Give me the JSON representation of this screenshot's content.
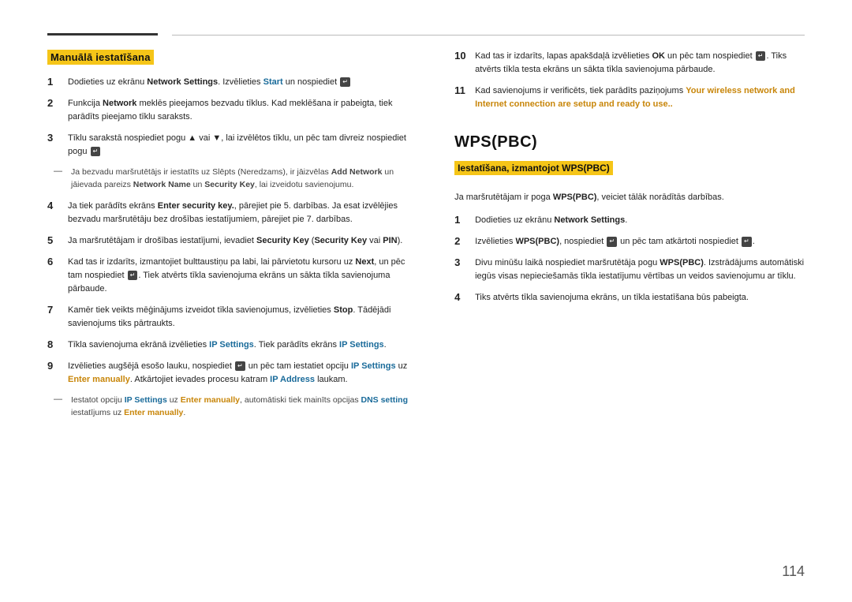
{
  "page_number": "114",
  "left_section": {
    "title": "Manuālā iestatīšana",
    "items": [
      {
        "num": "1",
        "text_parts": [
          {
            "text": "Dodieties uz ekrānu ",
            "style": "normal"
          },
          {
            "text": "Network Settings",
            "style": "bold"
          },
          {
            "text": ". Izvēlieties ",
            "style": "normal"
          },
          {
            "text": "Start",
            "style": "blue"
          },
          {
            "text": " un nospiediet ",
            "style": "normal"
          },
          {
            "text": "↵",
            "style": "icon"
          }
        ]
      },
      {
        "num": "2",
        "text_parts": [
          {
            "text": "Funkcija ",
            "style": "normal"
          },
          {
            "text": "Network",
            "style": "bold"
          },
          {
            "text": " meklēs pieejamos bezvadu tīklus. Kad meklēšana ir pabeigta, tiek parādīts pieejamo tīklu saraksts.",
            "style": "normal"
          }
        ]
      },
      {
        "num": "3",
        "text_parts": [
          {
            "text": "Tīklu sarakstā nospiediet pogu ",
            "style": "normal"
          },
          {
            "text": "▲",
            "style": "normal"
          },
          {
            "text": " vai ",
            "style": "normal"
          },
          {
            "text": "▼",
            "style": "normal"
          },
          {
            "text": ", lai izvēlētos tīklu, un pēc tam divreiz nospiediet pogu ",
            "style": "normal"
          },
          {
            "text": "↵",
            "style": "icon"
          }
        ],
        "note": {
          "dash": "—",
          "text_parts": [
            {
              "text": "Ja bezvadu maršrutētājs ir iestatīts uz Slēpts (Neredzams), ir jāizvēlas ",
              "style": "normal"
            },
            {
              "text": "Add Network",
              "style": "bold"
            },
            {
              "text": " un jāievada pareizs ",
              "style": "normal"
            },
            {
              "text": "Network Name",
              "style": "bold"
            },
            {
              "text": " un ",
              "style": "normal"
            },
            {
              "text": "Security Key",
              "style": "bold"
            },
            {
              "text": ", lai izveidotu savienojumu.",
              "style": "normal"
            }
          ]
        }
      },
      {
        "num": "4",
        "text_parts": [
          {
            "text": "Ja tiek parādīts ekrāns ",
            "style": "normal"
          },
          {
            "text": "Enter security key.",
            "style": "bold"
          },
          {
            "text": ", pārejiet pie 5. darbības. Ja esat izvēlējies bezvadu maršrutētāju bez drošības iestatījumiem, pārejiet pie 7. darbības.",
            "style": "normal"
          }
        ]
      },
      {
        "num": "5",
        "text_parts": [
          {
            "text": "Ja maršrutētājam ir drošības iestatījumi, ievadiet ",
            "style": "normal"
          },
          {
            "text": "Security Key",
            "style": "bold"
          },
          {
            "text": " (",
            "style": "normal"
          },
          {
            "text": "Security Key",
            "style": "bold"
          },
          {
            "text": " vai ",
            "style": "normal"
          },
          {
            "text": "PIN",
            "style": "bold"
          },
          {
            "text": ").",
            "style": "normal"
          }
        ]
      },
      {
        "num": "6",
        "text_parts": [
          {
            "text": "Kad tas ir izdarīts, izmantojiet bulttaustiņu pa labi, lai pārvietotu kursoru uz ",
            "style": "normal"
          },
          {
            "text": "Next",
            "style": "bold"
          },
          {
            "text": ", un pēc tam nospiediet ",
            "style": "normal"
          },
          {
            "text": "↵",
            "style": "icon"
          },
          {
            "text": ". Tiek atvērts tīkla savienojuma ekrāns un sākta tīkla savienojuma pārbaude.",
            "style": "normal"
          }
        ]
      },
      {
        "num": "7",
        "text_parts": [
          {
            "text": "Kamēr tiek veikts mēģinājums izveidot tīkla savienojumus, izvēlieties ",
            "style": "normal"
          },
          {
            "text": "Stop",
            "style": "bold"
          },
          {
            "text": ". Tādējādi savienojums tiks pārtraukts.",
            "style": "normal"
          }
        ]
      },
      {
        "num": "8",
        "text_parts": [
          {
            "text": "Tīkla savienojuma ekrānā izvēlieties ",
            "style": "normal"
          },
          {
            "text": "IP Settings",
            "style": "blue"
          },
          {
            "text": ". Tiek parādīts ekrāns ",
            "style": "normal"
          },
          {
            "text": "IP Settings",
            "style": "blue"
          },
          {
            "text": ".",
            "style": "normal"
          }
        ]
      },
      {
        "num": "9",
        "text_parts": [
          {
            "text": "Izvēlieties augšējā esošo lauku, nospiediet ",
            "style": "normal"
          },
          {
            "text": "↵",
            "style": "icon"
          },
          {
            "text": " un pēc tam iestatiet opciju ",
            "style": "normal"
          },
          {
            "text": "IP Settings",
            "style": "blue"
          },
          {
            "text": " uz ",
            "style": "normal"
          },
          {
            "text": "Enter manually",
            "style": "orange"
          },
          {
            "text": ". Atkārtojiet ievades procesu katram ",
            "style": "normal"
          },
          {
            "text": "IP Address",
            "style": "blue"
          },
          {
            "text": " laukam.",
            "style": "normal"
          }
        ],
        "note": {
          "dash": "—",
          "text_parts": [
            {
              "text": "Iestatot opciju ",
              "style": "normal"
            },
            {
              "text": "IP Settings",
              "style": "blue-small"
            },
            {
              "text": " uz ",
              "style": "normal"
            },
            {
              "text": "Enter manually",
              "style": "orange-small"
            },
            {
              "text": ", automātiski tiek mainīts opcijas ",
              "style": "normal"
            },
            {
              "text": "DNS setting",
              "style": "blue-small"
            },
            {
              "text": " iestatījums uz ",
              "style": "normal"
            },
            {
              "text": "Enter manually",
              "style": "orange-small"
            },
            {
              "text": ".",
              "style": "normal"
            }
          ]
        }
      }
    ]
  },
  "right_section": {
    "items_top": [
      {
        "num": "10",
        "text_parts": [
          {
            "text": "Kad tas ir izdarīts, lapas apakšdaļā izvēlieties ",
            "style": "normal"
          },
          {
            "text": "OK",
            "style": "bold"
          },
          {
            "text": " un pēc tam nospiediet ",
            "style": "normal"
          },
          {
            "text": "↵",
            "style": "icon"
          },
          {
            "text": ". Tiks atvērts tīkla testa ekrāns un sākta tīkla savienojuma pārbaude.",
            "style": "normal"
          }
        ]
      },
      {
        "num": "11",
        "text_parts": [
          {
            "text": "Kad savienojums ir verificēts, tiek parādīts paziņojums ",
            "style": "normal"
          },
          {
            "text": "Your wireless network and Internet connection are setup and ready to use..",
            "style": "orange-bold"
          }
        ]
      }
    ],
    "wps_title": "WPS(PBC)",
    "wps_section_title": "Iestatīšana, izmantojot WPS(PBC)",
    "wps_intro": "Ja maršrutētājam ir poga WPS(PBC), veiciet tālāk norādītās darbības.",
    "wps_intro_bold": "WPS(PBC)",
    "wps_items": [
      {
        "num": "1",
        "text_parts": [
          {
            "text": "Dodieties uz ekrānu ",
            "style": "normal"
          },
          {
            "text": "Network Settings",
            "style": "bold"
          },
          {
            "text": ".",
            "style": "normal"
          }
        ]
      },
      {
        "num": "2",
        "text_parts": [
          {
            "text": "Izvēlieties ",
            "style": "normal"
          },
          {
            "text": "WPS(PBC)",
            "style": "bold"
          },
          {
            "text": ", nospiediet ",
            "style": "normal"
          },
          {
            "text": "↵",
            "style": "icon"
          },
          {
            "text": " un pēc tam atkārtoti nospiediet ",
            "style": "normal"
          },
          {
            "text": "↵",
            "style": "icon"
          },
          {
            "text": ".",
            "style": "normal"
          }
        ]
      },
      {
        "num": "3",
        "text_parts": [
          {
            "text": "Divu minūšu laikā nospiediet maršrutētāja pogu ",
            "style": "normal"
          },
          {
            "text": "WPS(PBC)",
            "style": "bold"
          },
          {
            "text": ". Izstrādājums automātiski iegūs visas nepieciešamās tīkla iestatījumu vērtības un veidos savienojumu ar tīklu.",
            "style": "normal"
          }
        ]
      },
      {
        "num": "4",
        "text_parts": [
          {
            "text": "Tiks atvērts tīkla savienojuma ekrāns, un tīkla iestatīšana būs pabeigta.",
            "style": "normal"
          }
        ]
      }
    ]
  }
}
